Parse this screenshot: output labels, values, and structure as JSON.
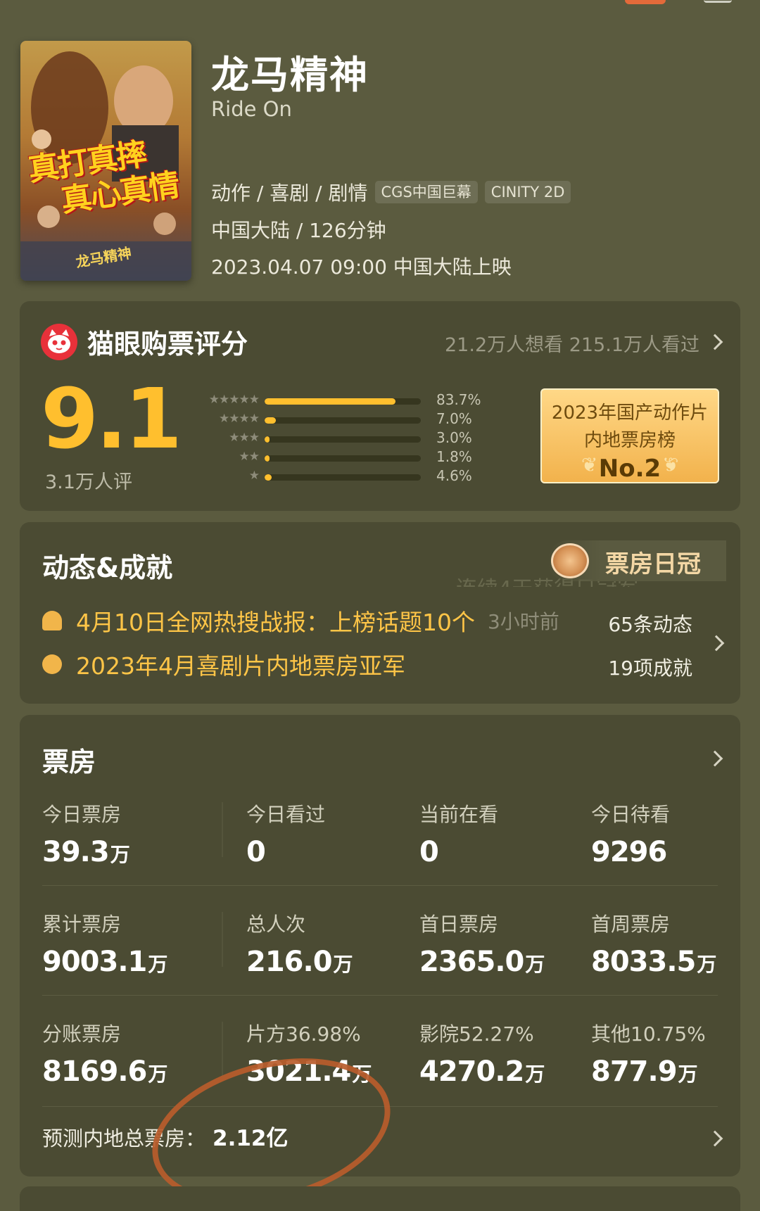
{
  "movie": {
    "title": "龙马精神",
    "title_en": "Ride On",
    "genres": [
      "动作",
      "喜剧",
      "剧情"
    ],
    "tags": [
      "CGS中国巨幕",
      "CINITY 2D"
    ],
    "region_duration": "中国大陆 / 126分钟",
    "release": "2023.04.07 09:00 中国大陆上映",
    "poster": {
      "slogan_line1": "真打真摔",
      "slogan_line2": "真心真情",
      "logo_text": "龙马精神"
    }
  },
  "rating": {
    "section_title": "猫眼购票评分",
    "want_watched": "21.2万人想看 215.1万人看过",
    "score": "9.1",
    "count": "3.1万人评",
    "distribution": [
      {
        "stars": "★★★★★",
        "percent": 83.7,
        "label": "83.7%"
      },
      {
        "stars": "★★★★",
        "percent": 7.0,
        "label": "7.0%"
      },
      {
        "stars": "★★★",
        "percent": 3.0,
        "label": "3.0%"
      },
      {
        "stars": "★★",
        "percent": 1.8,
        "label": "1.8%"
      },
      {
        "stars": "★",
        "percent": 4.6,
        "label": "4.6%"
      }
    ],
    "rank": {
      "line1": "2023年国产动作片",
      "line2": "内地票房榜",
      "no": "No.2"
    },
    "accent_color": "#ffbf2e"
  },
  "dynamics": {
    "section_title": "动态&成就",
    "badge_text": "票房日冠",
    "badge_subtext": "连续4天获得日冠军",
    "news": {
      "text": "4月10日全网热搜战报：上榜话题10个",
      "time": "3小时前",
      "count": "65条动态",
      "icon": "bell-icon"
    },
    "achievement": {
      "text": "2023年4月喜剧片内地票房亚军",
      "count": "19项成就",
      "icon": "medal-icon"
    }
  },
  "box_office": {
    "section_title": "票房",
    "rows": [
      [
        {
          "label": "今日票房",
          "value": "39.3",
          "unit": "万"
        },
        {
          "label": "今日看过",
          "value": "0",
          "unit": ""
        },
        {
          "label": "当前在看",
          "value": "0",
          "unit": ""
        },
        {
          "label": "今日待看",
          "value": "9296",
          "unit": ""
        }
      ],
      [
        {
          "label": "累计票房",
          "value": "9003.1",
          "unit": "万"
        },
        {
          "label": "总人次",
          "value": "216.0",
          "unit": "万"
        },
        {
          "label": "首日票房",
          "value": "2365.0",
          "unit": "万"
        },
        {
          "label": "首周票房",
          "value": "8033.5",
          "unit": "万"
        }
      ],
      [
        {
          "label": "分账票房",
          "value": "8169.6",
          "unit": "万"
        },
        {
          "label": "片方36.98%",
          "value": "3021.4",
          "unit": "万"
        },
        {
          "label": "影院52.27%",
          "value": "4270.2",
          "unit": "万"
        },
        {
          "label": "其他10.75%",
          "value": "877.9",
          "unit": "万"
        }
      ]
    ],
    "forecast_label": "预测内地总票房：",
    "forecast_value": "2.12亿"
  }
}
